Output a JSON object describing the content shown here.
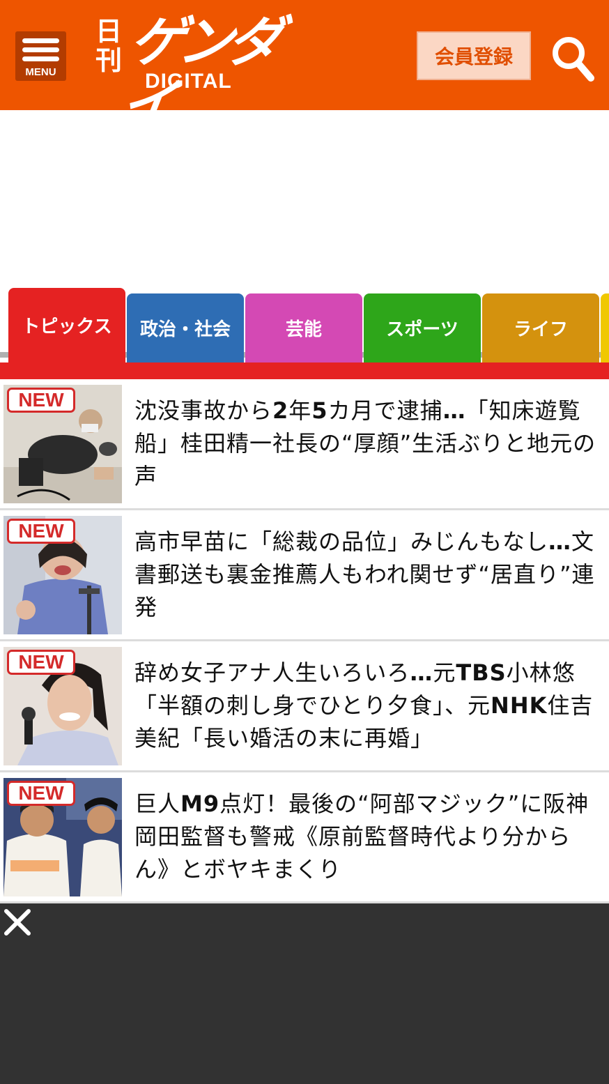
{
  "header": {
    "menu_label": "MENU",
    "logo_kanji": "日刊",
    "logo_katakana": "ゲンダイ",
    "logo_sub": "DIGITAL",
    "register_label": "会員登録",
    "search_icon": "search-icon",
    "brand_color": "#ee5500"
  },
  "tabs": [
    {
      "label": "トピックス",
      "color": "#e52222",
      "active": true
    },
    {
      "label": "政治・社会",
      "color": "#2e6db4",
      "active": false
    },
    {
      "label": "芸能",
      "color": "#d449b4",
      "active": false
    },
    {
      "label": "スポーツ",
      "color": "#2ea61a",
      "active": false
    },
    {
      "label": "ライフ",
      "color": "#d4920e",
      "active": false
    }
  ],
  "articles": [
    {
      "badge": "NEW",
      "headline": "沈没事故から2年5カ月で逮捕…「知床遊覧船」桂田精一社長の“厚顔”生活ぶりと地元の声"
    },
    {
      "badge": "NEW",
      "headline": "高市早苗に「総裁の品位」みじんもなし…文書郵送も裏金推薦人もわれ関せず“居直り”連発"
    },
    {
      "badge": "NEW",
      "headline": "辞め女子アナ人生いろいろ…元TBS小林悠「半額の刺し身でひとり夕食」、元NHK住吉美紀「長い婚活の末に再婚」"
    },
    {
      "badge": "NEW",
      "headline": "巨人M9点灯！最後の“阿部マジック”に阪神岡田監督も警戒《原前監督時代より分からん》とボヤキまくり"
    }
  ],
  "overlay": {
    "close_icon": "close-icon"
  }
}
